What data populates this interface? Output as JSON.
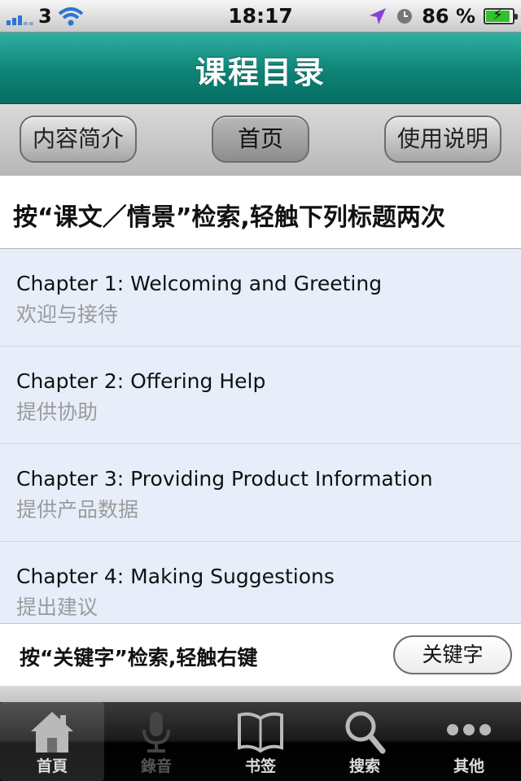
{
  "status_bar": {
    "carrier": "3",
    "time": "18:17",
    "battery": "86 %",
    "battery_level": 0.86
  },
  "nav": {
    "title": "课程目录"
  },
  "toolbar": {
    "left": "内容简介",
    "center": "首页",
    "right": "使用说明"
  },
  "instruction": "按“课文／情景”检索,轻触下列标题两次",
  "chapters": [
    {
      "title": "Chapter 1: Welcoming and Greeting",
      "subtitle": "欢迎与接待"
    },
    {
      "title": "Chapter 2: Offering Help",
      "subtitle": "提供协助"
    },
    {
      "title": "Chapter 3: Providing Product Information",
      "subtitle": "提供产品数据"
    },
    {
      "title": "Chapter 4: Making Suggestions",
      "subtitle": "提出建议"
    }
  ],
  "keyword_bar": {
    "text": "按“关键字”检索,轻触右键",
    "button": "关键字"
  },
  "tabs": [
    {
      "label": "首頁",
      "icon": "home-icon"
    },
    {
      "label": "錄音",
      "icon": "microphone-icon"
    },
    {
      "label": "书签",
      "icon": "book-icon"
    },
    {
      "label": "搜索",
      "icon": "search-icon"
    },
    {
      "label": "其他",
      "icon": "more-icon"
    }
  ],
  "colors": {
    "accent": "#0e8376",
    "list_bg": "#e7eefa",
    "battery_green": "#32c12a"
  }
}
